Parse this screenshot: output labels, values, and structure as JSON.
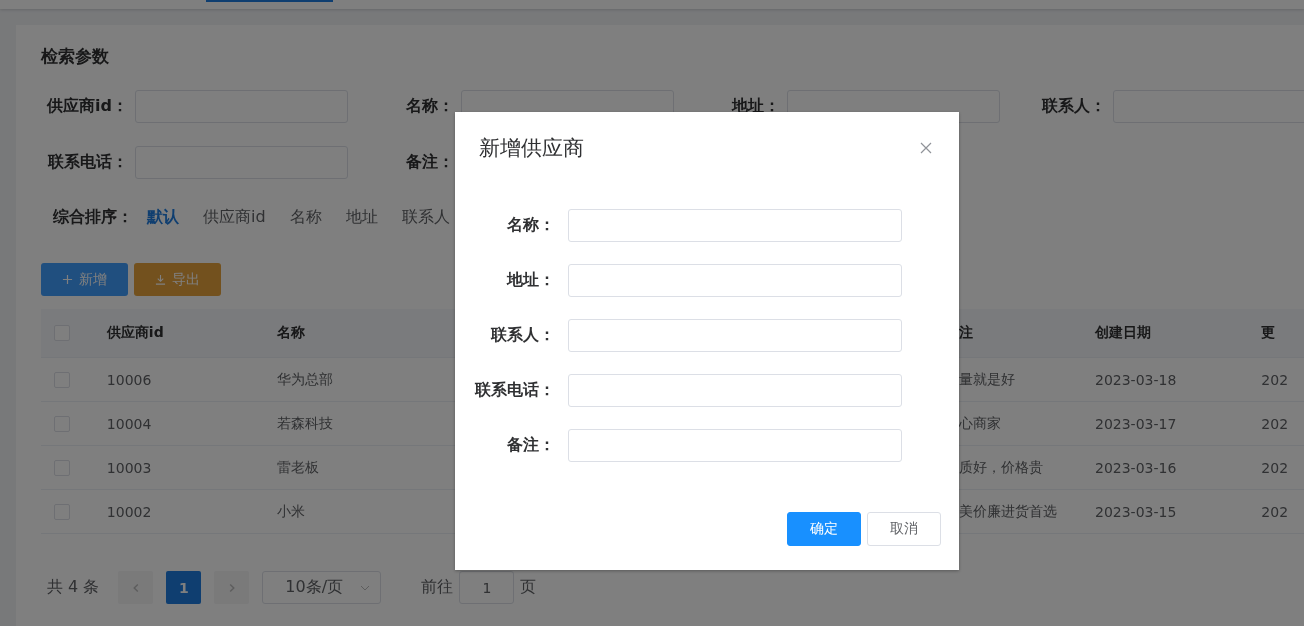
{
  "search": {
    "title": "检索参数",
    "fields": [
      {
        "kind": "input",
        "label": "供应商id："
      },
      {
        "kind": "input",
        "label": "名称："
      },
      {
        "kind": "input",
        "label": "地址："
      },
      {
        "kind": "input",
        "label": "联系人："
      },
      {
        "kind": "input",
        "label": "联系电话："
      },
      {
        "kind": "label",
        "label": "备注："
      }
    ],
    "sort_label": "综合排序：",
    "sort_options": [
      {
        "label": "默认",
        "selected": true
      },
      {
        "label": "供应商id",
        "selected": false
      },
      {
        "label": "名称",
        "selected": false
      },
      {
        "label": "地址",
        "selected": false
      },
      {
        "label": "联系人",
        "selected": false
      }
    ]
  },
  "actions": [
    {
      "kind": "add",
      "label": "新增"
    },
    {
      "kind": "export",
      "label": "导出"
    }
  ],
  "table": {
    "header_checked": false,
    "columns": [
      "供应商id",
      "名称",
      "注",
      "创建日期",
      "更"
    ],
    "rows": [
      {
        "checked": false,
        "cells": [
          "10006",
          "华为总部",
          "量就是好",
          "2023-03-18",
          "202"
        ]
      },
      {
        "checked": false,
        "cells": [
          "10004",
          "若森科技",
          "心商家",
          "2023-03-17",
          "202"
        ]
      },
      {
        "checked": false,
        "cells": [
          "10003",
          "雷老板",
          "质好，价格贵",
          "2023-03-16",
          "202"
        ]
      },
      {
        "checked": false,
        "cells": [
          "10002",
          "小米",
          "美价廉进货首选",
          "2023-03-15",
          "202"
        ]
      }
    ]
  },
  "pagination": {
    "total": "共 4 条",
    "pages": [
      {
        "label": "1",
        "selected": true
      }
    ],
    "page_size": "10条/页",
    "goto_label": "前往",
    "goto_value": "1",
    "goto_suffix": "页"
  },
  "dialog": {
    "title": "新增供应商",
    "fields": [
      {
        "label": "名称："
      },
      {
        "label": "地址："
      },
      {
        "label": "联系人："
      },
      {
        "label": "联系电话："
      },
      {
        "label": "备注："
      }
    ],
    "buttons": [
      {
        "kind": "primary",
        "label": "确定"
      },
      {
        "kind": "default",
        "label": "取消"
      }
    ]
  }
}
